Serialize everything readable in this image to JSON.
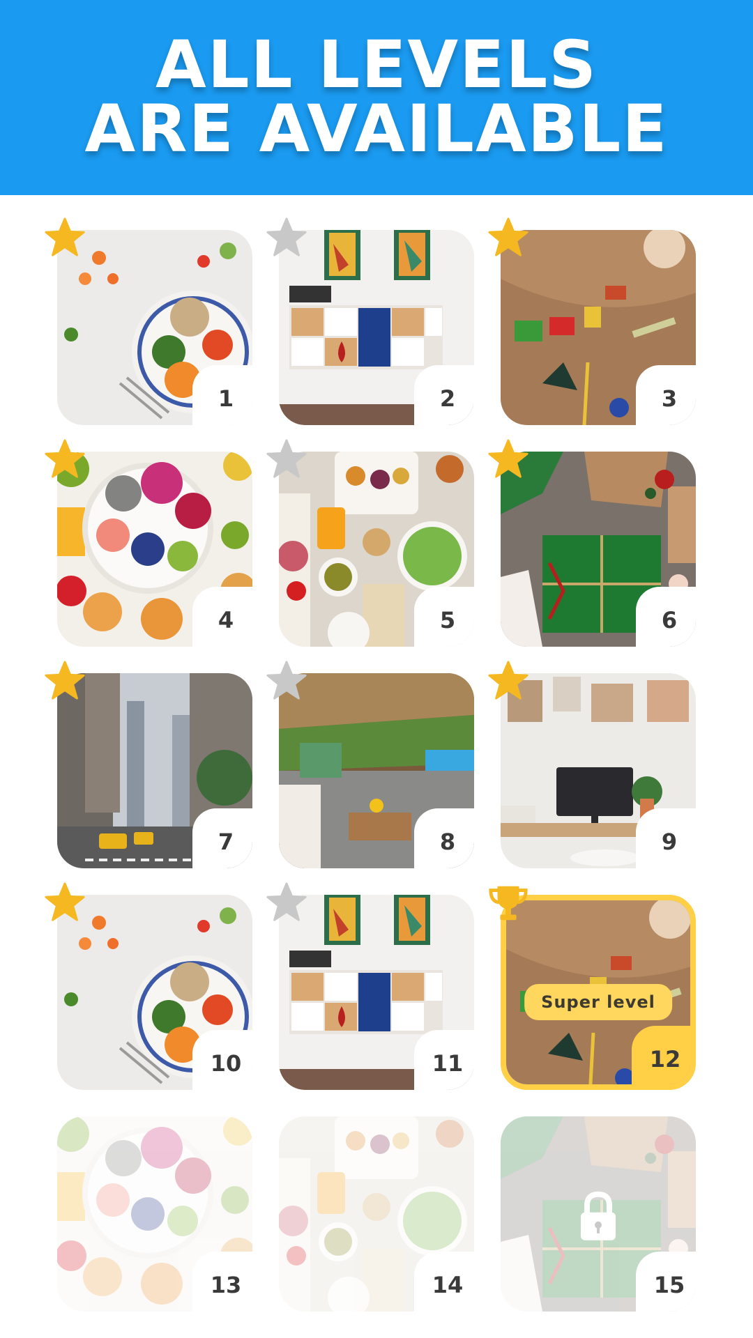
{
  "header": {
    "line1": "ALL LEVELS",
    "line2": "ARE AVAILABLE",
    "background": "#1a9af0"
  },
  "colors": {
    "star_gold": "#f5b820",
    "star_gray": "#c8c8c8",
    "super_border": "#ffcf45"
  },
  "levels": [
    {
      "number": "1",
      "theme": "food-bowl",
      "star": "gold",
      "state": "open"
    },
    {
      "number": "2",
      "theme": "art-shelf",
      "star": "gray",
      "state": "open"
    },
    {
      "number": "3",
      "theme": "toys",
      "star": "gold",
      "state": "open"
    },
    {
      "number": "4",
      "theme": "fruit-bowl",
      "star": "gold",
      "state": "open"
    },
    {
      "number": "5",
      "theme": "brunch-table",
      "star": "gray",
      "state": "open"
    },
    {
      "number": "6",
      "theme": "gift-box",
      "star": "gold",
      "state": "open"
    },
    {
      "number": "7",
      "theme": "city-street",
      "star": "gold",
      "state": "open"
    },
    {
      "number": "8",
      "theme": "patio",
      "star": "gray",
      "state": "open"
    },
    {
      "number": "9",
      "theme": "desk",
      "star": "gold",
      "state": "open"
    },
    {
      "number": "10",
      "theme": "food-bowl",
      "star": "gold",
      "state": "open"
    },
    {
      "number": "11",
      "theme": "art-shelf",
      "star": "gray",
      "state": "open"
    },
    {
      "number": "12",
      "theme": "toys",
      "star": "trophy",
      "state": "super",
      "label": "Super level"
    },
    {
      "number": "13",
      "theme": "fruit-bowl",
      "star": "none",
      "state": "locked"
    },
    {
      "number": "14",
      "theme": "brunch-table",
      "star": "none",
      "state": "locked"
    },
    {
      "number": "15",
      "theme": "gift-box",
      "star": "none",
      "state": "locked",
      "lock": "lock-icon"
    }
  ]
}
